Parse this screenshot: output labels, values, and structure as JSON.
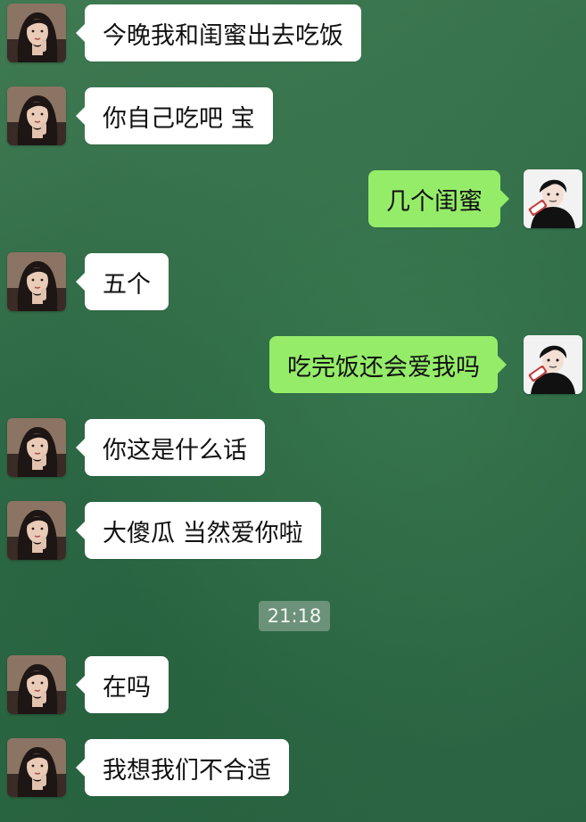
{
  "messages": [
    {
      "side": "incoming",
      "text": "今晚我和闺蜜出去吃饭"
    },
    {
      "side": "incoming",
      "text": "你自己吃吧 宝"
    },
    {
      "side": "outgoing",
      "text": "几个闺蜜"
    },
    {
      "side": "incoming",
      "text": "五个"
    },
    {
      "side": "outgoing",
      "text": "吃完饭还会爱我吗"
    },
    {
      "side": "incoming",
      "text": "你这是什么话"
    },
    {
      "side": "incoming",
      "text": "大傻瓜 当然爱你啦"
    },
    {
      "side": "incoming",
      "text": "在吗"
    },
    {
      "side": "incoming",
      "text": "我想我们不合适"
    }
  ],
  "timestamp": "21:18",
  "colors": {
    "incoming_bubble": "#ffffff",
    "outgoing_bubble": "#95ec69",
    "background": "#2f6b47"
  }
}
